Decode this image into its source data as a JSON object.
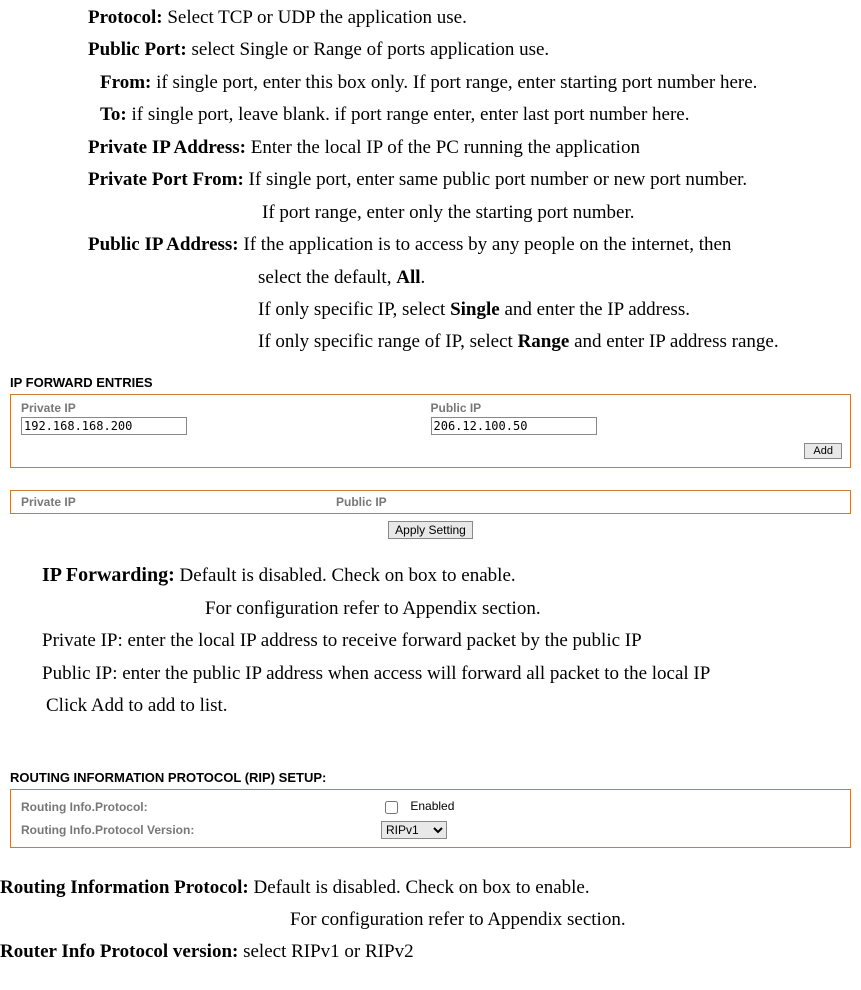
{
  "defs": {
    "protocol_label": "Protocol:",
    "protocol_text": " Select TCP or UDP the application use.",
    "publicport_label": "Public Port:",
    "publicport_text": " select Single or Range of ports application use.",
    "from_label": "From:",
    "from_text": " if single port, enter this box only. If port range, enter starting port number here.",
    "to_label": "To:",
    "to_text": " if single port, leave blank. if port range enter, enter last port number here.",
    "privateip_label": "Private IP Address:",
    "privateip_text": " Enter the local IP of the PC running the application",
    "privateportfrom_label": "Private Port From:",
    "privateportfrom_text": " If single port, enter same public port number or new port number.",
    "privateportfrom_text2": "If port range, enter only the starting port number.",
    "publicipaddr_label": "Public IP Address:",
    "publicipaddr_text1a": " If the application is to access by any people on the internet, then",
    "publicipaddr_text1b": "select the default, ",
    "all_bold": "All",
    "period": ".",
    "publicipaddr_text2a": "If only specific IP, select ",
    "single_bold": "Single",
    "publicipaddr_text2b": " and enter the IP address.",
    "publicipaddr_text3a": "If only specific range of IP, select ",
    "range_bold": "Range",
    "publicipaddr_text3b": " and enter IP address range."
  },
  "ipforward": {
    "heading": "IP FORWARD ENTRIES",
    "privateip_label": "Private IP",
    "privateip_value": "192.168.168.200",
    "publicip_label": "Public IP",
    "publicip_value": "206.12.100.50",
    "add_btn": "Add",
    "table_private": "Private IP",
    "table_public": "Public IP",
    "apply_btn": "Apply Setting"
  },
  "ipforwarding_defs": {
    "heading_label": "IP Forwarding:",
    "heading_text": " Default is disabled. Check on box to enable.",
    "line2": "For configuration refer to Appendix section.",
    "privateip": "Private IP: enter the local IP address to receive forward packet by the public IP",
    "publicip": "Public IP: enter the public IP address when access will forward all packet to the local IP",
    "clickadd": "Click Add to add to list."
  },
  "rip": {
    "heading": "ROUTING INFORMATION PROTOCOL (RIP) SETUP:",
    "row1_label": "Routing Info.Protocol:",
    "row1_text": "Enabled",
    "row2_label": "Routing Info.Protocol Version:",
    "row2_select": "RIPv1"
  },
  "rip_defs": {
    "heading_label": "Routing Information Protocol:",
    "heading_text": " Default is disabled. Check on box to enable.",
    "line2": "For configuration refer to Appendix section.",
    "version_label": "Router Info Protocol version:",
    "version_text": " select RIPv1 or RIPv2"
  }
}
